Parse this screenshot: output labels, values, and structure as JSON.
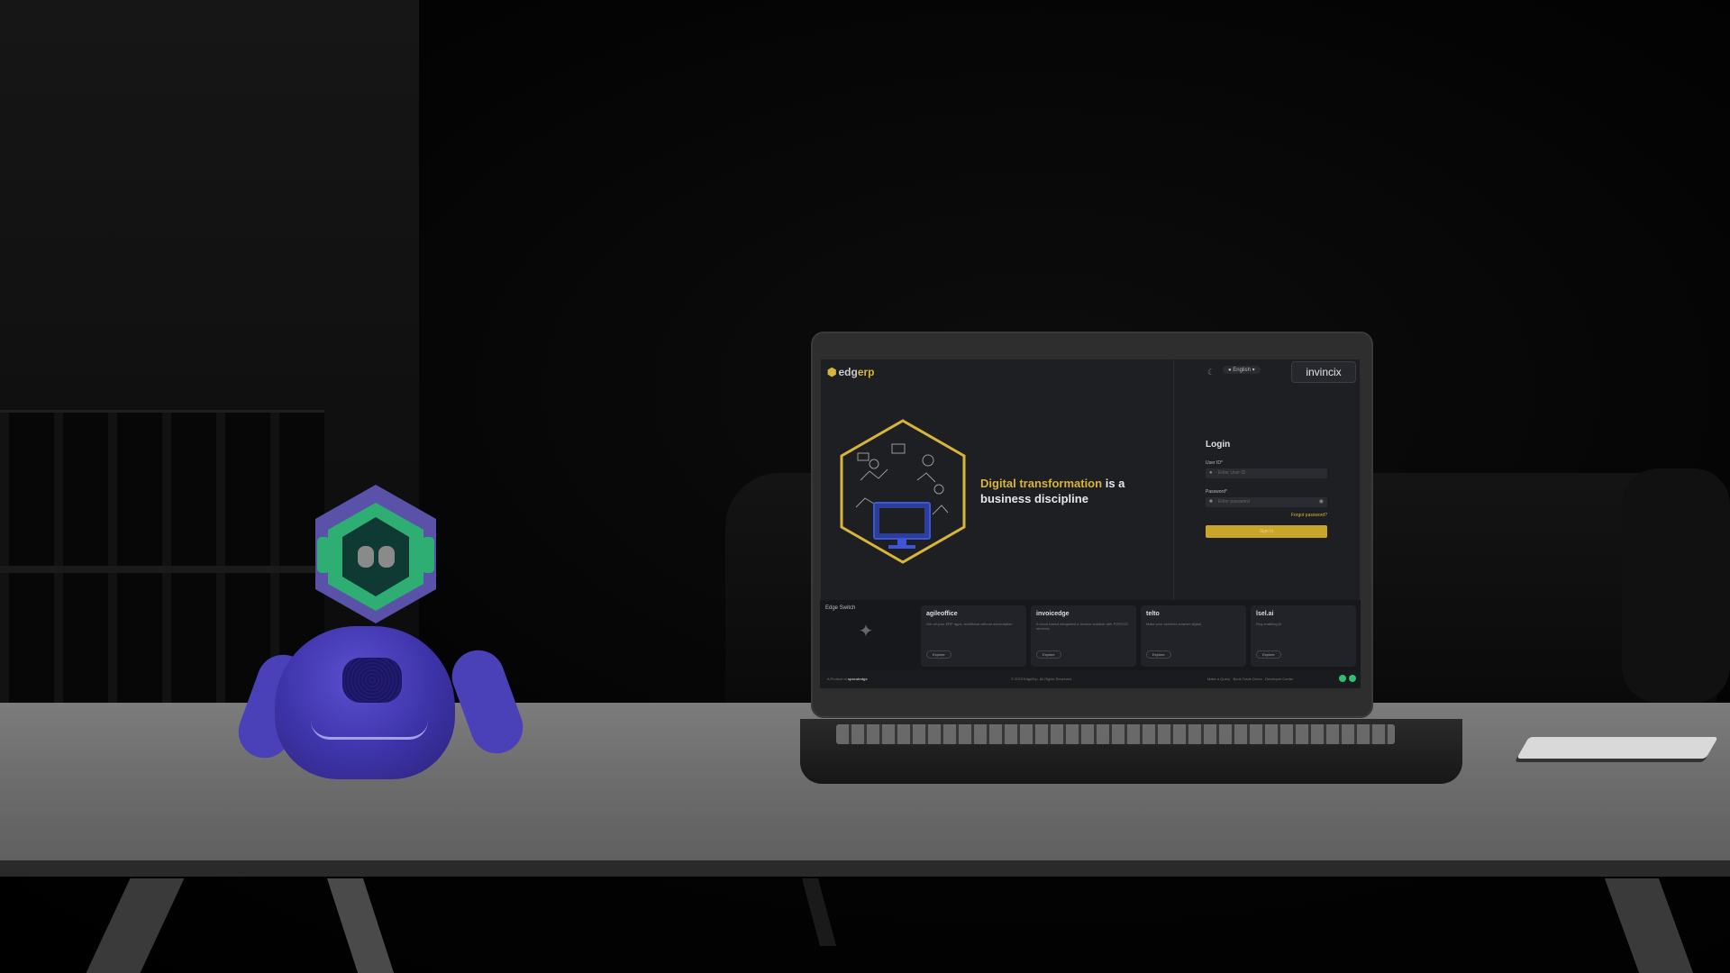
{
  "brand": {
    "logo_prefix": "edg",
    "logo_suffix": "erp",
    "partner_logo": "invincix"
  },
  "header": {
    "theme_icon": "moon-icon",
    "language": "English"
  },
  "hero": {
    "highlight": "Digital transformation",
    "rest": "is a business discipline"
  },
  "login": {
    "title": "Login",
    "user_label": "User ID*",
    "user_placeholder": "Enter User ID",
    "password_label": "Password*",
    "password_placeholder": "Enter password",
    "forgot": "Forgot password?",
    "submit": "Sign In"
  },
  "suite": {
    "label": "Edge Switch"
  },
  "products": [
    {
      "name": "agileoffice",
      "desc": "Get all your ERP apps, workflows without subscription",
      "action": "Explore"
    },
    {
      "name": "invoicedge",
      "desc": "A cloud based integrated e-Invoice solution with P2P/O2C services",
      "action": "Explore"
    },
    {
      "name": "telto",
      "desc": "Make your services smarter digital",
      "action": "Explore"
    },
    {
      "name": "lsel.ai",
      "desc": "Reg enabling AI",
      "action": "Explore"
    }
  ],
  "footer": {
    "product_of": "A Product of",
    "company": "sproutedge",
    "copyright": "© 2023 EdgeErp. All Rights Reserved.",
    "links": [
      "Make a Query",
      "Book Trade Demo",
      "Developer Center"
    ]
  },
  "colors": {
    "accent": "#d9b43a",
    "robot_body": "#3d33a8",
    "robot_face": "#2fae73"
  }
}
